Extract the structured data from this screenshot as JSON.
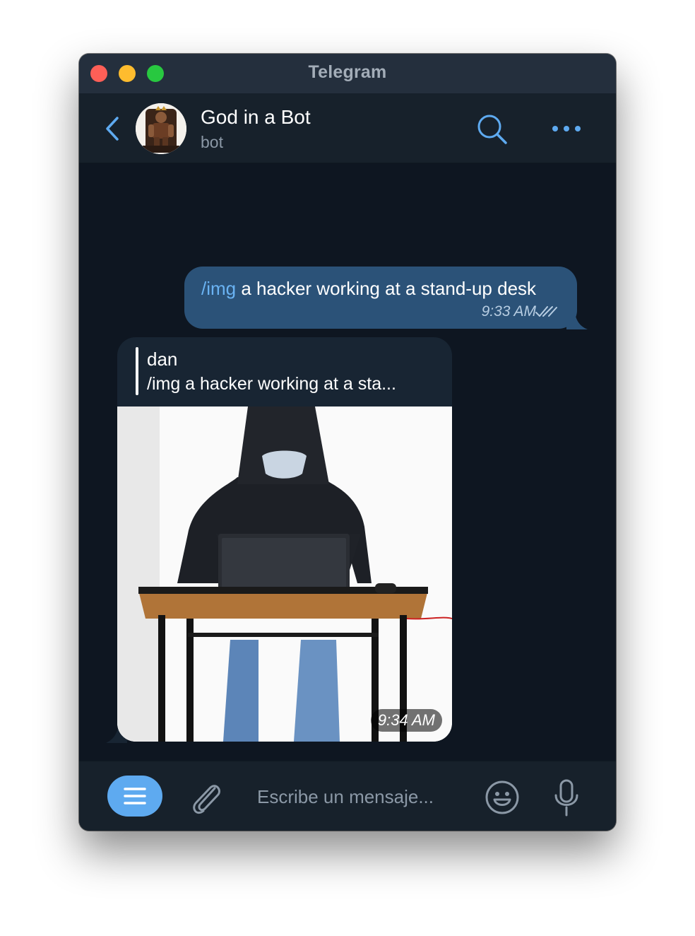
{
  "window": {
    "title": "Telegram"
  },
  "chat": {
    "name": "God in a Bot",
    "status": "bot"
  },
  "messages": {
    "outgoing": {
      "command": "/img",
      "text": " a hacker working at a stand-up desk",
      "time": "9:33 AM"
    },
    "incoming": {
      "reply_name": "dan",
      "reply_text": "/img a hacker working at a sta...",
      "time": "9:34 AM"
    }
  },
  "composer": {
    "placeholder": "Escribe un mensaje..."
  },
  "icons": {
    "back": "chevron-left-icon",
    "search": "search-icon",
    "more": "more-dots-icon",
    "menu": "menu-icon",
    "attach": "paperclip-icon",
    "emoji": "smiley-icon",
    "mic": "microphone-icon",
    "read": "double-check-icon"
  },
  "colors": {
    "accent": "#5eaaf0",
    "outgoing_bubble": "#2b5278",
    "incoming_bubble": "#182533",
    "chat_background": "#0e1621"
  }
}
